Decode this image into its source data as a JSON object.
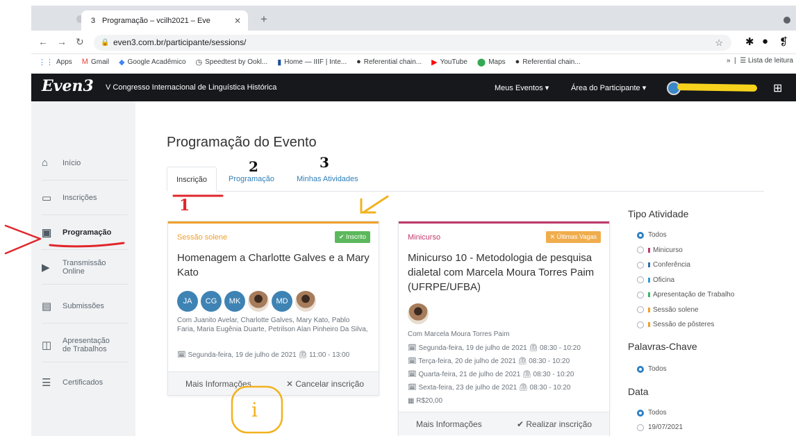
{
  "browser": {
    "tab_title": "Programação – vcilh2021 – Eve",
    "url": "even3.com.br/participante/sessions/",
    "bookmarks": [
      {
        "label": "Apps",
        "icon": "apps-grid-icon",
        "color": "#4285f4"
      },
      {
        "label": "Gmail",
        "icon": "gmail-icon",
        "color": "#ea4335"
      },
      {
        "label": "Google Acadêmico",
        "icon": "scholar-icon",
        "color": "#4285f4"
      },
      {
        "label": "Speedtest by Ookl...",
        "icon": "speedtest-icon",
        "color": "#333333"
      },
      {
        "label": "Home — IIIF | Inte...",
        "icon": "iiif-icon",
        "color": "#1d4f9a"
      },
      {
        "label": "Referential chain...",
        "icon": "globe-icon",
        "color": "#333333"
      },
      {
        "label": "YouTube",
        "icon": "youtube-icon",
        "color": "#ff0000"
      },
      {
        "label": "Maps",
        "icon": "maps-icon",
        "color": "#34a853"
      },
      {
        "label": "Referential chain...",
        "icon": "globe-icon",
        "color": "#333333"
      }
    ],
    "reading_list": "Lista de leitura"
  },
  "header": {
    "logo": "Even3",
    "event_name": "V Congresso Internacional de Linguística Histórica",
    "nav_events": "Meus Eventos ▾",
    "nav_participant": "Área do Participante ▾"
  },
  "sidebar": {
    "items": [
      {
        "label": "Início",
        "icon": "home-icon"
      },
      {
        "label": "Inscrições",
        "icon": "ticket-icon"
      },
      {
        "label": "Programação",
        "icon": "calendar-icon"
      },
      {
        "label": "Transmissão Online",
        "icon": "play-icon"
      },
      {
        "label": "Submissões",
        "icon": "document-icon"
      },
      {
        "label": "Apresentação de Trabalhos",
        "icon": "presentation-icon"
      },
      {
        "label": "Certificados",
        "icon": "certificate-icon"
      }
    ]
  },
  "main": {
    "title": "Programação do Evento",
    "tabs": [
      "Inscrição",
      "Programação",
      "Minhas Atividades"
    ]
  },
  "cards": [
    {
      "kind": "Sessão solene",
      "kind_color": "#f0a02c",
      "badge": "✔ Inscrito",
      "badge_color": "#5cb85c",
      "title": "Homenagem a Charlotte Galves e a Mary Kato",
      "initials": [
        "JA",
        "CG",
        "MK",
        "MD"
      ],
      "people": "Com Juanito Avelar, Charlotte Galves, Mary Kato, Pablo Faria, Maria Eugênia Duarte, Petrilson Alan Pinheiro Da Silva,",
      "schedule": [
        "Segunda-feira, 19 de julho de 2021   ⏲ 11:00 - 13:00"
      ],
      "more": "Mais Informações",
      "action": "✕ Cancelar inscrição"
    },
    {
      "kind": "Minicurso",
      "kind_color": "#c0396b",
      "badge": "✕ Últimas Vagas",
      "badge_color": "#f0ad4e",
      "title": "Minicurso 10 - Metodologia de pesquisa dialetal com Marcela Moura Torres Paim (UFRPE/UFBA)",
      "people": "Com Marcela Moura Torres Paim",
      "schedule": [
        "Segunda-feira, 19 de julho de 2021   ⏲ 08:30 - 10:20",
        "Terça-feira, 20 de julho de 2021   ⏲ 08:30 - 10:20",
        "Quarta-feira, 21 de julho de 2021   ⏲ 08:30 - 10:20",
        "Sexta-feira, 23 de julho de 2021   ⏲ 08:30 - 10:20"
      ],
      "price": "R$20,00",
      "more": "Mais Informações",
      "action": "✔ Realizar inscrição"
    }
  ],
  "filters": {
    "type_title": "Tipo Atividade",
    "types": [
      {
        "label": "Todos",
        "selected": true,
        "color": ""
      },
      {
        "label": "Minicurso",
        "selected": false,
        "color": "#c0396b"
      },
      {
        "label": "Conferência",
        "selected": false,
        "color": "#2f6fb0"
      },
      {
        "label": "Oficina",
        "selected": false,
        "color": "#2f9bd6"
      },
      {
        "label": "Apresentação de Trabalho",
        "selected": false,
        "color": "#3cb56b"
      },
      {
        "label": "Sessão solene",
        "selected": false,
        "color": "#f0a02c"
      },
      {
        "label": "Sessão de pôsteres",
        "selected": false,
        "color": "#f0a02c"
      }
    ],
    "keywords_title": "Palavras-Chave",
    "keywords": [
      {
        "label": "Todos",
        "selected": true
      }
    ],
    "date_title": "Data",
    "dates": [
      {
        "label": "Todos",
        "selected": true
      },
      {
        "label": "19/07/2021",
        "selected": false
      }
    ]
  },
  "annotations": {
    "num1": "1",
    "num2": "2",
    "num3": "3",
    "info": "i",
    "ink_red": "#e0262b",
    "ink_orange": "#f2b21f"
  }
}
